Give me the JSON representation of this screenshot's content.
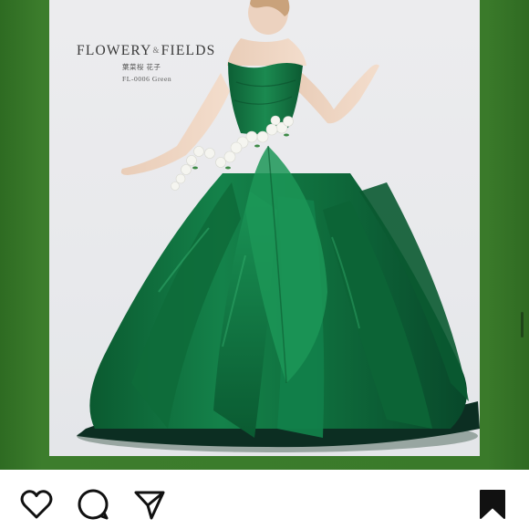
{
  "post": {
    "brand": {
      "title_left": "FLOWERY",
      "separator": "&",
      "title_right": "FIELDS",
      "designer": "葉菜桜 花子",
      "product_code": "FL-0006 Green"
    },
    "image_subject": "green-ballgown-photo"
  },
  "actions": {
    "like": "heart-icon",
    "comment": "comment-bubble-icon",
    "share": "paper-plane-icon",
    "save": "bookmark-icon"
  },
  "colors": {
    "background_green": "#3a7a2a",
    "gown_green": "#0f6a3a",
    "card_background": "#ececee",
    "icon_color": "#111111"
  }
}
